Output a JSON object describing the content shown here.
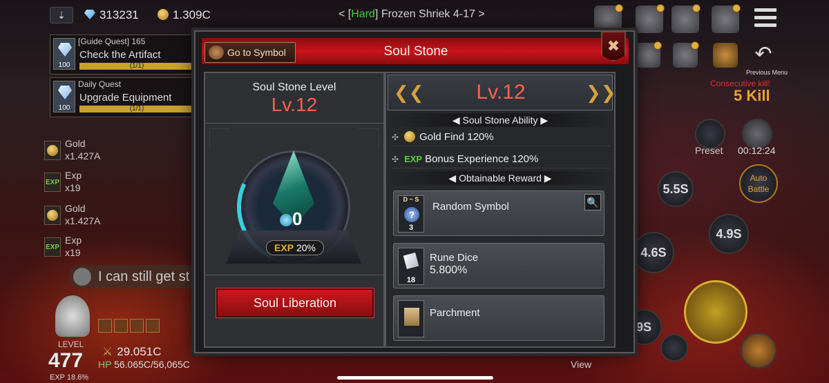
{
  "top": {
    "gems": "313231",
    "gold": "1.309C",
    "stage_prefix": "< [",
    "difficulty": "Hard",
    "stage_name": "] Frozen Shriek 4-17 >"
  },
  "quests": [
    {
      "type": "[Guide Quest] 165",
      "title": "Check the Artifact",
      "progress": "(1/1)",
      "level": "100"
    },
    {
      "type": "Daily Quest",
      "title": "Upgrade Equipment",
      "progress": "(1/1)",
      "level": "100"
    }
  ],
  "loot": [
    {
      "icon": "gold",
      "name": "Gold",
      "amount": "x1.427A"
    },
    {
      "icon": "exp",
      "name": "Exp",
      "amount": "x19"
    },
    {
      "icon": "gold",
      "name": "Gold",
      "amount": "x1.427A"
    },
    {
      "icon": "exp",
      "name": "Exp",
      "amount": "x19"
    }
  ],
  "loot_exp_badge": "EXP",
  "chat": "I can still get st",
  "player": {
    "level_label": "LEVEL",
    "level": "477",
    "attack": "29.051C",
    "hp_label": "HP",
    "hp": "56.065C/56,065C",
    "exp": "EXP 18.6%"
  },
  "hud": {
    "previous_menu": "Previous Menu",
    "consecutive_kill": "Consecutive kill!",
    "kills": "5 Kill",
    "preset": "Preset",
    "timer": "00:12:24",
    "auto_battle": "Auto Battle",
    "skill_cooldowns": [
      "5.5S",
      "4.9S",
      "4.6S",
      "9S"
    ],
    "view": "View"
  },
  "modal": {
    "title": "Soul Stone",
    "goto_symbol": "Go to Symbol",
    "soul_stone_level_label": "Soul Stone Level",
    "soul_stone_level": "Lv.12",
    "stone_count": "0",
    "exp_label": "EXP",
    "exp_percent": "20%",
    "exp_progress": 0.2,
    "liberation_button": "Soul Liberation",
    "detail_level": "Lv.12",
    "ability_header": "Soul Stone Ability",
    "abilities": [
      {
        "icon": "gold-coin-icon",
        "name": "Gold Find",
        "value": "120%"
      },
      {
        "icon": "exp-icon",
        "prefix": "EXP",
        "name": "Bonus Experience",
        "value": "120%"
      }
    ],
    "reward_header": "Obtainable Reward",
    "rewards": [
      {
        "name": "Random Symbol",
        "grade": "D ~ S",
        "count": "3",
        "detail": ""
      },
      {
        "name": "Rune Dice",
        "count": "18",
        "detail": "5.800%"
      },
      {
        "name": "Parchment",
        "count": "",
        "detail": ""
      }
    ]
  }
}
